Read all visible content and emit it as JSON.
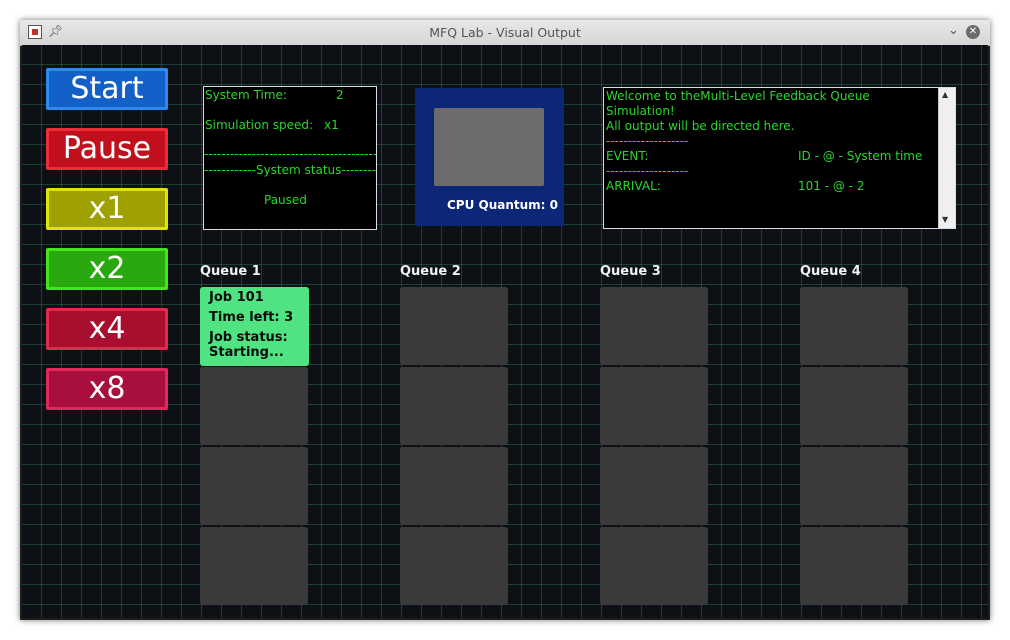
{
  "window": {
    "title": "MFQ Lab - Visual Output"
  },
  "controls": {
    "buttons": [
      {
        "label": "Start",
        "bg": "#1260c8",
        "border": "#2f8af0"
      },
      {
        "label": "Pause",
        "bg": "#c10f1e",
        "border": "#ee2d36"
      },
      {
        "label": "x1",
        "bg": "#9fa002",
        "border": "#e2e309"
      },
      {
        "label": "x2",
        "bg": "#2aa80f",
        "border": "#45e41d"
      },
      {
        "label": "x4",
        "bg": "#a80f2e",
        "border": "#e3294d"
      },
      {
        "label": "x8",
        "bg": "#a80f3e",
        "border": "#e3295a"
      }
    ]
  },
  "status": {
    "system_time_label": "System Time:",
    "system_time_value": "2",
    "speed_label": "Simulation speed:",
    "speed_value": "x1",
    "separator": "------------------------------------------",
    "system_status_header": "------------System status---------",
    "system_status_value": "Paused"
  },
  "cpu": {
    "quantum_label": "CPU Quantum: 0"
  },
  "log": {
    "lines": [
      "Welcome to theMulti-Level Feedback Queue",
      "Simulation!",
      "All output will be directed here.",
      "-------------------"
    ],
    "event_label": "EVENT:",
    "event_header": "ID    - @ - System time",
    "separator2": "-------------------",
    "arrival_label": "ARRIVAL:",
    "arrival_value": "101 - @ - 2"
  },
  "queues": [
    {
      "label": "Queue 1"
    },
    {
      "label": "Queue 2"
    },
    {
      "label": "Queue 3"
    },
    {
      "label": "Queue 4"
    }
  ],
  "job": {
    "id_label": "Job 101",
    "time_left": "Time left: 3",
    "status_label": "Job status:",
    "status_value": "Starting...",
    "color": "#4fe381"
  }
}
